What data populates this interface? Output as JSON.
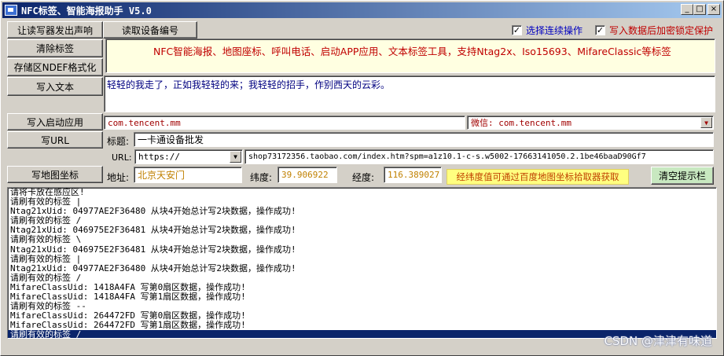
{
  "window": {
    "title": "NFC标签、智能海报助手 V5.0",
    "minimize": "_",
    "maximize": "□",
    "close": "×"
  },
  "buttons": {
    "beep": "让读写器发出声响",
    "read_serial": "读取设备编号",
    "clear_tag": "清除标签",
    "format_ndef": "存储区NDEF格式化",
    "write_text": "写入文本",
    "write_app": "写入启动应用",
    "write_url": "写URL",
    "write_map": "写地图坐标",
    "clear_hint": "清空提示栏"
  },
  "options": {
    "continuous": {
      "label": "选择连续操作",
      "checked": "✓",
      "color": "#0000c0"
    },
    "lock": {
      "label": "写入数据后加密锁定保护",
      "checked": "✓",
      "color": "#c00000"
    }
  },
  "banner": "NFC智能海报、地图座标、呼叫电话、启动APP应用、文本标签工具，支持Ntag2x、Iso15693、MifareClassic等标签",
  "text_content": "轻轻的我走了，正如我轻轻的来；我轻轻的招手，作别西天的云彩。",
  "app": {
    "package": "com.tencent.mm",
    "combo_value": "微信: com.tencent.mm"
  },
  "url": {
    "title_label": "标题:",
    "title_value": "一卡通设备批发",
    "prefix_label": "URL:",
    "prefix_value": "https://",
    "address_value": "shop73172356.taobao.com/index.htm?spm=a1z10.1-c-s.w5002-17663141050.2.1be46baaD90Gf7"
  },
  "map": {
    "address_label": "地址:",
    "address_value": "北京天安门",
    "lat_label": "纬度:",
    "lat_value": "39.906922",
    "lng_label": "经度:",
    "lng_value": "116.389027",
    "hint": "经纬度值可通过百度地图坐标拾取器获取"
  },
  "log": [
    "请将卡放在感应区!",
    "请刷有效的标签 |",
    "Ntag21xUid: 04977AE2F36480 从块4开始总计写2块数据，操作成功!",
    "请刷有效的标签 /",
    "Ntag21xUid: 046975E2F36481 从块4开始总计写2块数据，操作成功!",
    "请刷有效的标签 \\",
    "Ntag21xUid: 046975E2F36481 从块4开始总计写2块数据，操作成功!",
    "请刷有效的标签 |",
    "Ntag21xUid: 04977AE2F36480 从块4开始总计写2块数据，操作成功!",
    "请刷有效的标签 /",
    "MifareClassUid: 1418A4FA 写第0扇区数据，操作成功!",
    "MifareClassUid: 1418A4FA 写第1扇区数据，操作成功!",
    "请刷有效的标签 --",
    "MifareClassUid: 264472FD 写第0扇区数据，操作成功!",
    "MifareClassUid: 264472FD 写第1扇区数据，操作成功!",
    "请刷有效的标签 /"
  ],
  "watermark": "CSDN @津津有味道"
}
